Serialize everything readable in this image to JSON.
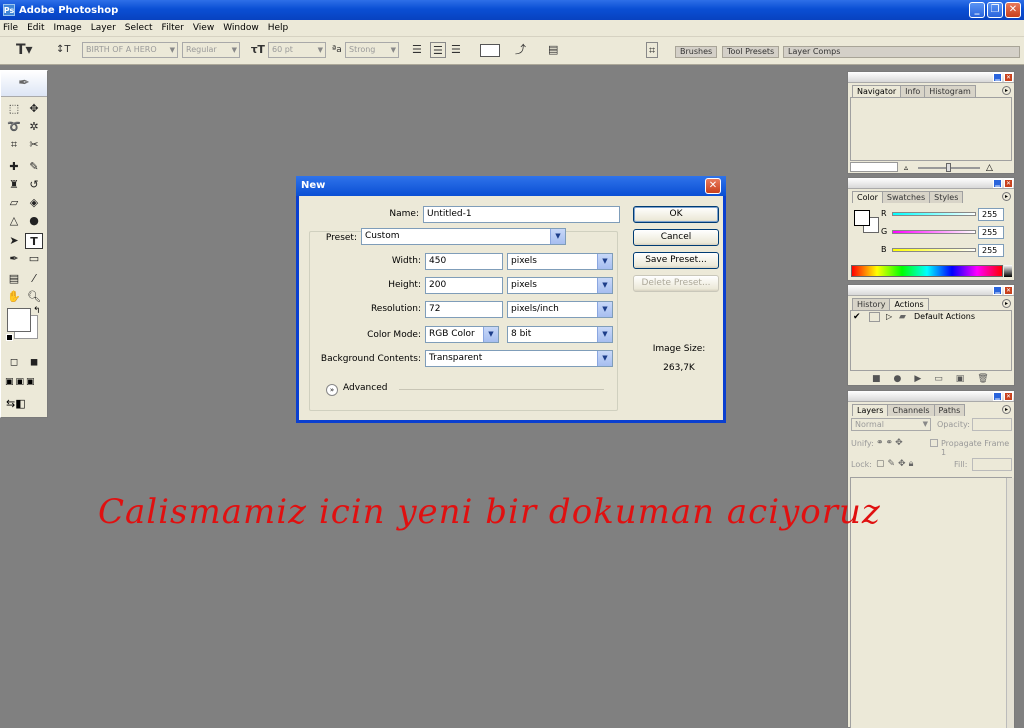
{
  "app": {
    "title": "Adobe Photoshop"
  },
  "menu": [
    "File",
    "Edit",
    "Image",
    "Layer",
    "Select",
    "Filter",
    "View",
    "Window",
    "Help"
  ],
  "options": {
    "font_family": "BIRTH OF A HERO",
    "font_style": "Regular",
    "font_size": "60 pt",
    "antialias": "Strong",
    "wells": [
      "Brushes",
      "Tool Presets",
      "Layer Comps"
    ]
  },
  "dialog": {
    "title": "New",
    "name_label": "Name:",
    "name_value": "Untitled-1",
    "preset_label": "Preset:",
    "preset_value": "Custom",
    "width_label": "Width:",
    "width_value": "450",
    "width_unit": "pixels",
    "height_label": "Height:",
    "height_value": "200",
    "height_unit": "pixels",
    "resolution_label": "Resolution:",
    "resolution_value": "72",
    "resolution_unit": "pixels/inch",
    "colormode_label": "Color Mode:",
    "colormode_value": "RGB Color",
    "bitdepth_value": "8 bit",
    "bg_label": "Background Contents:",
    "bg_value": "Transparent",
    "advanced_label": "Advanced",
    "ok": "OK",
    "cancel": "Cancel",
    "save_preset": "Save Preset...",
    "delete_preset": "Delete Preset...",
    "image_size_label": "Image Size:",
    "image_size_value": "263,7K"
  },
  "panels": {
    "navigator": {
      "tabs": [
        "Navigator",
        "Info",
        "Histogram"
      ]
    },
    "color": {
      "tabs": [
        "Color",
        "Swatches",
        "Styles"
      ],
      "r_label": "R",
      "g_label": "G",
      "b_label": "B",
      "r": "255",
      "g": "255",
      "b": "255"
    },
    "history": {
      "tabs": [
        "History",
        "Actions"
      ],
      "item": "Default Actions"
    },
    "layers": {
      "tabs": [
        "Layers",
        "Channels",
        "Paths"
      ],
      "blend": "Normal",
      "opacity_label": "Opacity:",
      "unify_label": "Unify:",
      "propagate_label": "Propagate Frame 1",
      "lock_label": "Lock:",
      "fill_label": "Fill:"
    }
  },
  "annotation": "Calismamiz icin yeni bir dokuman aciyoruz"
}
